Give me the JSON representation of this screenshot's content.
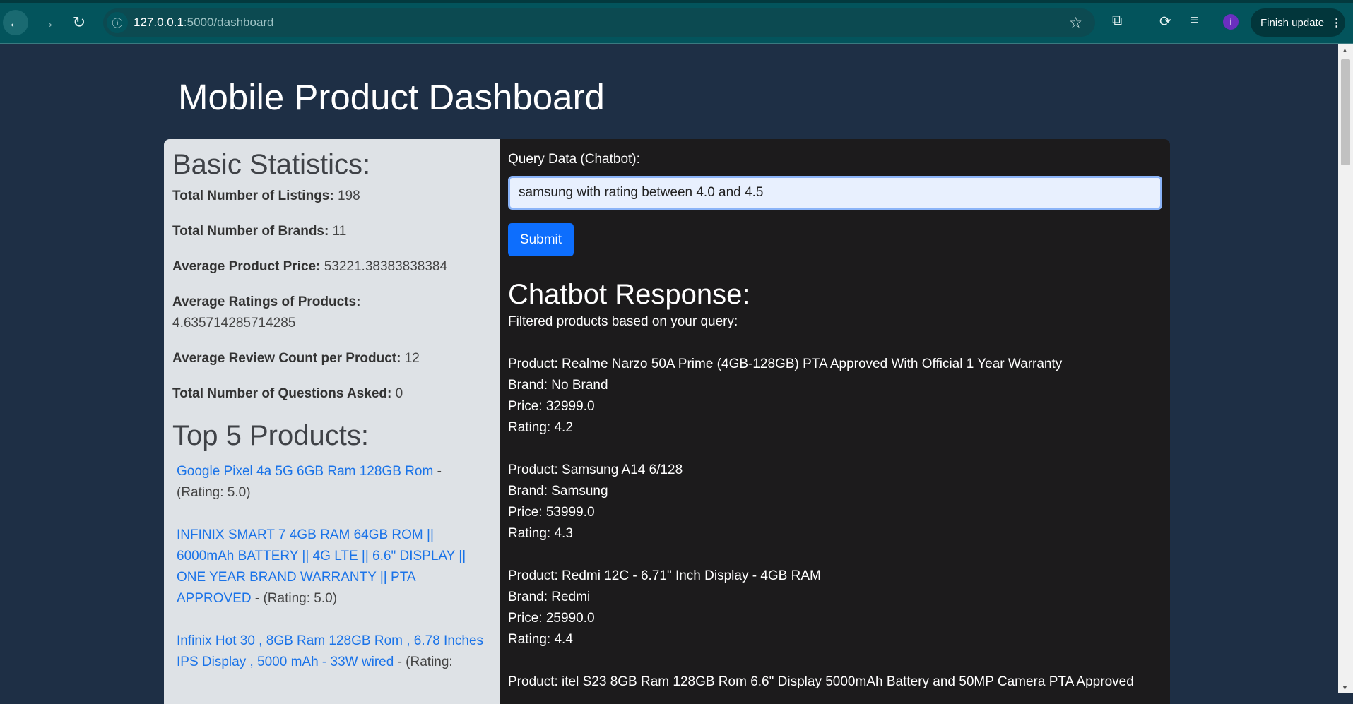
{
  "browser": {
    "url_host": "127.0.0.1",
    "url_path": ":5000/dashboard",
    "finish_update": "Finish update",
    "profile_initial": "i"
  },
  "page": {
    "title": "Mobile Product Dashboard"
  },
  "stats": {
    "heading": "Basic Statistics:",
    "items": [
      {
        "label": "Total Number of Listings:",
        "value": "198"
      },
      {
        "label": "Total Number of Brands:",
        "value": "11"
      },
      {
        "label": "Average Product Price:",
        "value": "53221.38383838384"
      },
      {
        "label": "Average Ratings of Products:",
        "value": "4.635714285714285"
      },
      {
        "label": "Average Review Count per Product:",
        "value": "12"
      },
      {
        "label": "Total Number of Questions Asked:",
        "value": "0"
      }
    ]
  },
  "top_products": {
    "heading": "Top 5 Products:",
    "items": [
      {
        "name": "Google Pixel 4a 5G 6GB Ram 128GB Rom",
        "rating": " - (Rating: 5.0)"
      },
      {
        "name": "INFINIX SMART 7 4GB RAM 64GB ROM || 6000mAh BATTERY || 4G LTE || 6.6\" DISPLAY || ONE YEAR BRAND WARRANTY || PTA APPROVED",
        "rating": " - (Rating: 5.0)"
      },
      {
        "name": "Infinix Hot 30 , 8GB Ram 128GB Rom , 6.78 Inches IPS Display , 5000 mAh - 33W wired",
        "rating": " - (Rating:"
      }
    ]
  },
  "query": {
    "label": "Query Data (Chatbot):",
    "value": "samsung with rating between 4.0 and 4.5",
    "submit": "Submit"
  },
  "response": {
    "heading": "Chatbot Response:",
    "intro": "Filtered products based on your query:",
    "products": [
      {
        "product": "Product: Realme Narzo 50A Prime (4GB-128GB) PTA Approved With Official 1 Year Warranty",
        "brand": "Brand: No Brand",
        "price": "Price: 32999.0",
        "rating": "Rating: 4.2"
      },
      {
        "product": "Product: Samsung A14 6/128",
        "brand": "Brand: Samsung",
        "price": "Price: 53999.0",
        "rating": "Rating: 4.3"
      },
      {
        "product": "Product: Redmi 12C - 6.71\" Inch Display - 4GB RAM",
        "brand": "Brand: Redmi",
        "price": "Price: 25990.0",
        "rating": "Rating: 4.4"
      },
      {
        "product": "Product: itel S23 8GB Ram 128GB Rom 6.6\" Display 5000mAh Battery and 50MP Camera PTA Approved"
      }
    ]
  }
}
